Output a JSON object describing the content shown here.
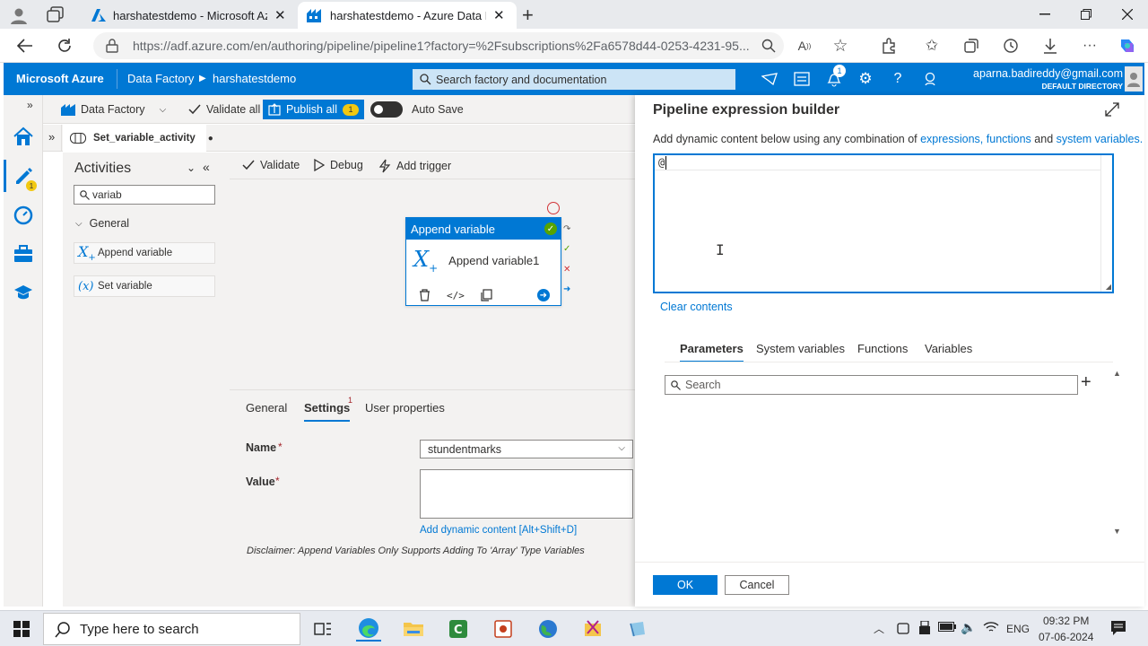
{
  "browser": {
    "tabs": [
      {
        "title": "harshatestdemo - Microsoft Azur"
      },
      {
        "title": "harshatestdemo - Azure Data Fac"
      }
    ],
    "url": "https://adf.azure.com/en/authoring/pipeline/pipeline1?factory=%2Fsubscriptions%2Fa6578d44-0253-4231-95..."
  },
  "azure_header": {
    "brand": "Microsoft Azure",
    "service": "Data Factory",
    "factory": "harshatestdemo",
    "search_placeholder": "Search factory and documentation",
    "notification_count": "1",
    "user_email": "aparna.badireddy@gmail.com",
    "directory": "DEFAULT DIRECTORY"
  },
  "rail": {
    "edit_badge": "1"
  },
  "factory_toolbar": {
    "data_factory": "Data Factory",
    "validate_all": "Validate all",
    "publish_all": "Publish all",
    "publish_count": "1",
    "auto_save": "Auto Save"
  },
  "pipeline_tab": {
    "name": "Set_variable_activity"
  },
  "activities": {
    "title": "Activities",
    "search_value": "variab",
    "group": "General",
    "items": [
      {
        "label": "Append variable"
      },
      {
        "label": "Set variable"
      }
    ]
  },
  "canvas_toolbar": {
    "validate": "Validate",
    "debug": "Debug",
    "add_trigger": "Add trigger"
  },
  "activity_card": {
    "type": "Append variable",
    "name": "Append variable1"
  },
  "properties": {
    "tabs": [
      {
        "label": "General"
      },
      {
        "label": "Settings",
        "badge": "1"
      },
      {
        "label": "User properties"
      }
    ],
    "name_label": "Name",
    "name_value": "stundentmarks",
    "value_label": "Value",
    "required_mark": "*",
    "add_dynamic": "Add dynamic content [Alt+Shift+D]",
    "disclaimer": "Disclaimer: Append Variables Only Supports Adding To 'Array' Type Variables"
  },
  "expression_builder": {
    "title": "Pipeline expression builder",
    "desc_prefix": "Add dynamic content below using any combination of ",
    "link_expressions": "expressions,",
    "link_functions": "functions",
    "desc_and": " and ",
    "link_system": "system variables.",
    "content": "@",
    "clear": "Clear contents",
    "tabs": [
      {
        "label": "Parameters"
      },
      {
        "label": "System variables"
      },
      {
        "label": "Functions"
      },
      {
        "label": "Variables"
      }
    ],
    "search_placeholder": "Search",
    "ok": "OK",
    "cancel": "Cancel"
  },
  "taskbar": {
    "search_placeholder": "Type here to search",
    "lang": "ENG",
    "time": "09:32 PM",
    "date": "07-06-2024"
  }
}
